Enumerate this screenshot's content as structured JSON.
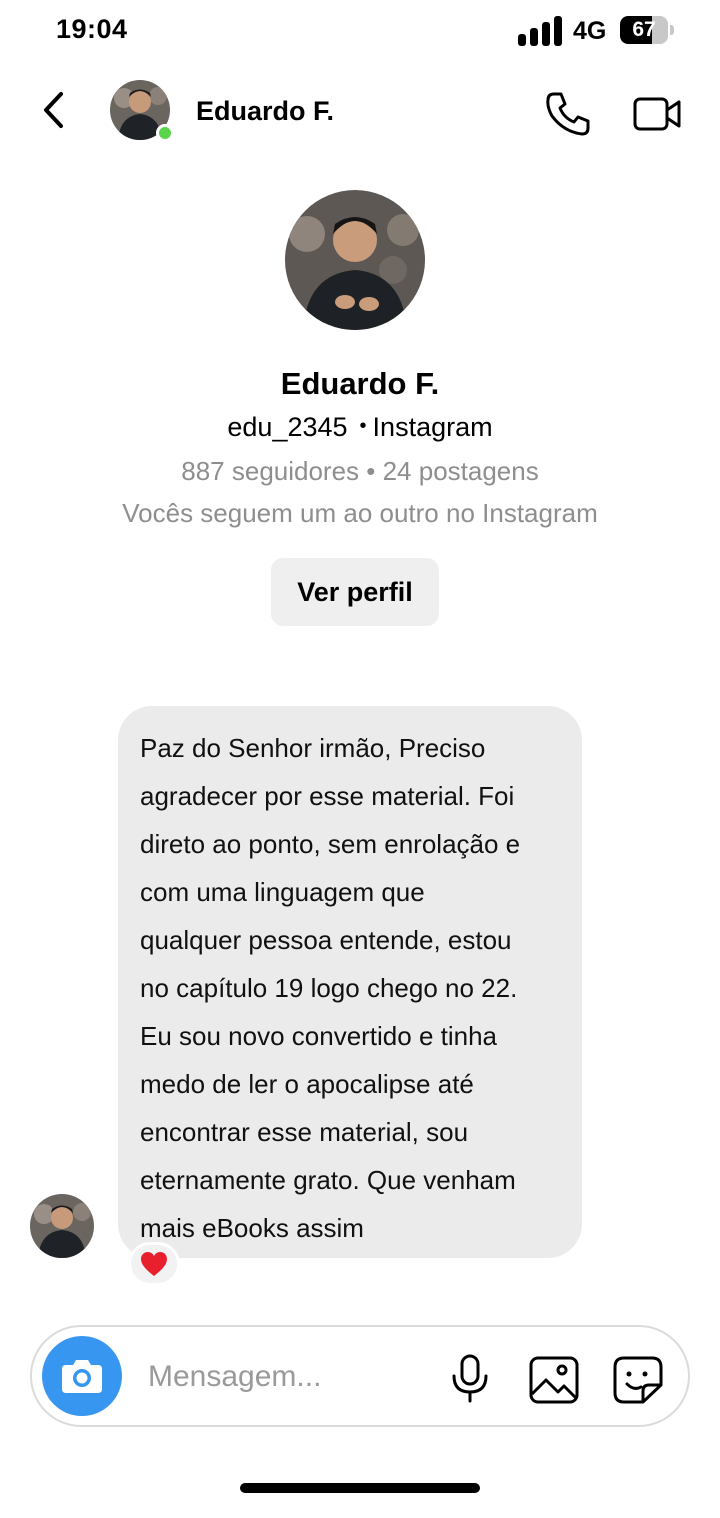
{
  "status_bar": {
    "time": "19:04",
    "network": "4G",
    "battery_percent": "67",
    "battery_level": 0.67
  },
  "header": {
    "name": "Eduardo F.",
    "online": true,
    "icons": {
      "back": "chevron-left-icon",
      "call": "phone-icon",
      "video": "video-camera-icon"
    }
  },
  "profile": {
    "name": "Eduardo F.",
    "handle": "edu_2345",
    "platform": "Instagram",
    "stats": "887 seguidores • 24 postagens",
    "mutual": "Vocês seguem um ao outro no Instagram",
    "view_profile_label": "Ver perfil"
  },
  "message": {
    "lines": [
      "Paz do Senhor irmão, Preciso",
      "agradecer por esse material. Foi",
      "direto ao ponto, sem enrolação e",
      "com uma linguagem que",
      "qualquer pessoa entende, estou",
      "no capítulo 19 logo chego no 22.",
      "Eu sou novo convertido e tinha",
      "medo de ler o apocalipse até",
      "encontrar esse material, sou",
      "eternamente grato. Que venham",
      "mais eBooks assim"
    ],
    "reaction": "heart-icon"
  },
  "composer": {
    "placeholder": "Mensagem...",
    "icons": {
      "camera": "camera-icon",
      "mic": "microphone-icon",
      "gallery": "image-icon",
      "sticker": "sticker-icon"
    }
  },
  "colors": {
    "accent": "#3797f0",
    "online": "#5bd34a",
    "bubble": "#ebebeb",
    "secondary_text": "#8e8e8e",
    "reaction": "#e8202e"
  }
}
